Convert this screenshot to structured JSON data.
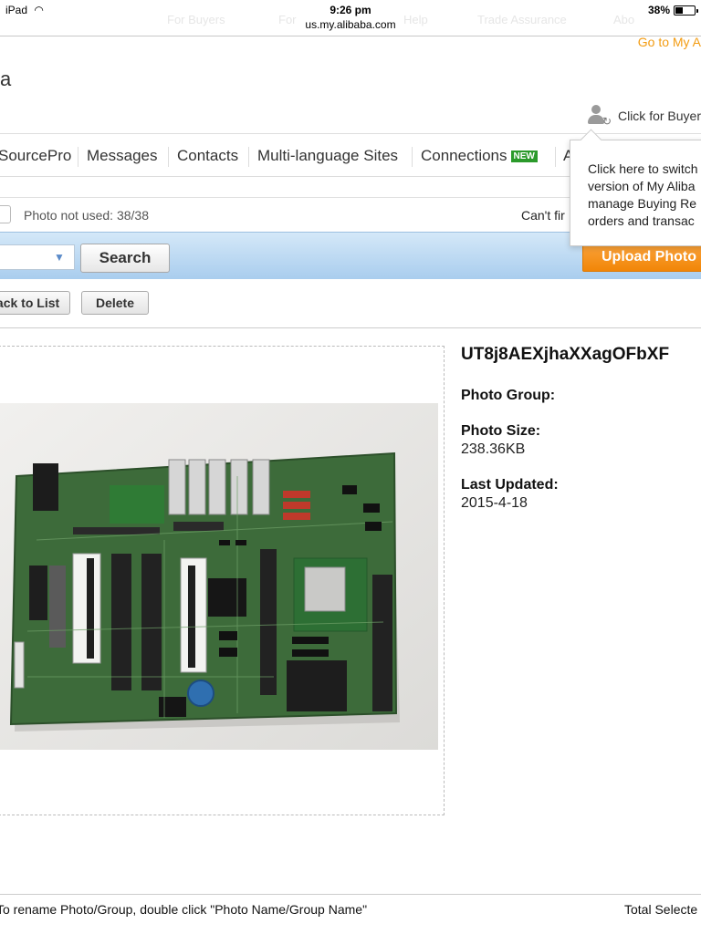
{
  "status_bar": {
    "device": "iPad",
    "time": "9:26 pm",
    "url": "us.my.alibaba.com",
    "battery": "38%",
    "battery_level": 0.38
  },
  "top_nav_faded": [
    "For Buyers",
    "For",
    "Help",
    "Trade Assurance",
    "Abo"
  ],
  "header": {
    "goto_link": "Go to My A",
    "logo_fragment": "a",
    "buyer_switch_label": "Click for Buyer"
  },
  "main_nav": {
    "items": [
      {
        "label": "SourcePro"
      },
      {
        "label": "Messages"
      },
      {
        "label": "Contacts"
      },
      {
        "label": "Multi-language Sites"
      },
      {
        "label": "Connections",
        "badge": "NEW"
      },
      {
        "label": "A"
      }
    ]
  },
  "popover": {
    "lines": [
      "Click here to switch",
      "version of My Aliba",
      "manage Buying Re",
      "orders and transac"
    ]
  },
  "photo_row": {
    "photo_not_used": "Photo not used: 38/38",
    "cant_find": "Can't fir"
  },
  "search_bar": {
    "search_label": "Search",
    "upload_label": "Upload Photo"
  },
  "actions": {
    "back_label": "Back to List",
    "delete_label": "Delete"
  },
  "photo_details": {
    "name": "UT8j8AEXjhaXXagOFbXF",
    "group_label": "Photo Group:",
    "group_value": "",
    "size_label": "Photo Size:",
    "size_value": "238.36KB",
    "updated_label": "Last Updated:",
    "updated_value": "2015-4-18"
  },
  "footer": {
    "hint": "To rename Photo/Group, double click \"Photo Name/Group Name\"",
    "total": "Total Selecte"
  },
  "colors": {
    "accent_orange": "#f18607",
    "link_orange": "#f39c12",
    "nav_blue_bar": "#a9cdee",
    "new_badge_green": "#2b9a2b"
  }
}
